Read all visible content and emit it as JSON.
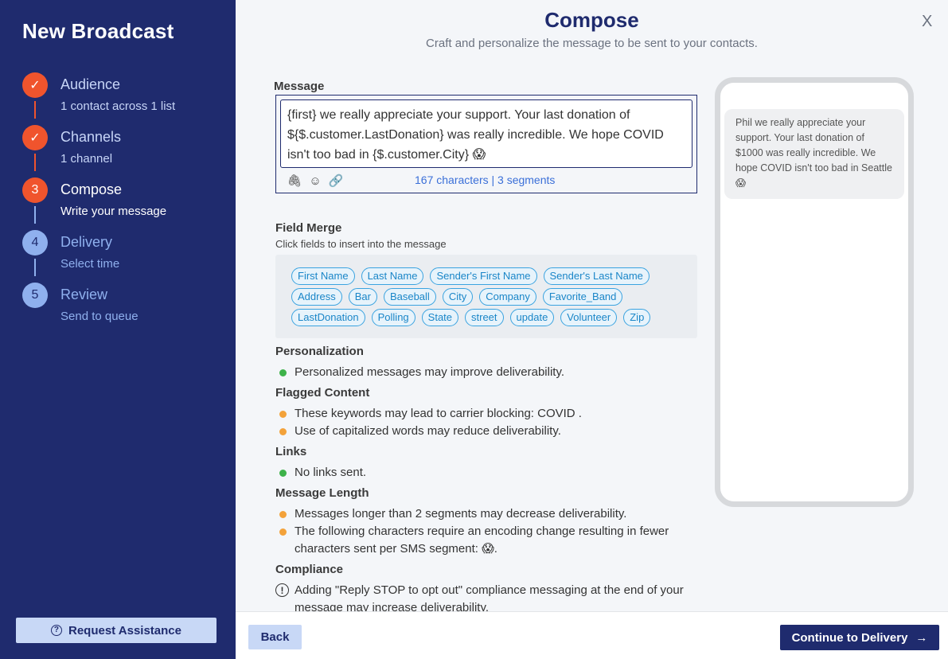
{
  "sidebar": {
    "title": "New Broadcast",
    "steps": [
      {
        "marker": "✓",
        "title": "Audience",
        "subtitle": "1 contact across 1 list",
        "state": "done"
      },
      {
        "marker": "✓",
        "title": "Channels",
        "subtitle": "1 channel",
        "state": "done"
      },
      {
        "marker": "3",
        "title": "Compose",
        "subtitle": "Write your message",
        "state": "current"
      },
      {
        "marker": "4",
        "title": "Delivery",
        "subtitle": "Select time",
        "state": "future"
      },
      {
        "marker": "5",
        "title": "Review",
        "subtitle": "Send to queue",
        "state": "future"
      }
    ],
    "assist_label": "Request Assistance",
    "assist_icon": "?"
  },
  "header": {
    "title": "Compose",
    "subtitle": "Craft and personalize the message to be sent to your contacts.",
    "close": "X"
  },
  "message": {
    "label": "Message",
    "text": "{first} we really appreciate your support.  Your last donation of ${$.customer.LastDonation} was really incredible.  We hope COVID isn't too bad in {$.customer.City} 😱",
    "count": "167 characters | 3 segments",
    "tool_icons": {
      "attach": "🖇",
      "emoji": "☺",
      "link": "🔗"
    }
  },
  "field_merge": {
    "label": "Field Merge",
    "hint": "Click fields to insert into the message",
    "rows": [
      [
        "First Name",
        "Last Name",
        "Sender's First Name",
        "Sender's Last Name"
      ],
      [
        "Address",
        "Bar",
        "Baseball",
        "City",
        "Company",
        "Favorite_Band"
      ],
      [
        "LastDonation",
        "Polling",
        "State",
        "street",
        "update",
        "Volunteer",
        "Zip"
      ]
    ]
  },
  "checks": {
    "personalization": {
      "title": "Personalization",
      "items": [
        "Personalized messages may improve deliverability."
      ]
    },
    "flagged": {
      "title": "Flagged Content",
      "items": [
        "These keywords may lead to carrier blocking: COVID .",
        "Use of capitalized words may reduce deliverability."
      ]
    },
    "links": {
      "title": "Links",
      "items": [
        "No links sent."
      ]
    },
    "length": {
      "title": "Message Length",
      "items": [
        "Messages longer than 2 segments may decrease deliverability.",
        "The following characters require an encoding change resulting in fewer characters sent per SMS segment: 😱."
      ]
    },
    "compliance": {
      "title": "Compliance",
      "items": [
        "Adding \"Reply STOP to opt out\" compliance messaging at the end of your message may increase deliverability."
      ],
      "icon": "!"
    }
  },
  "preview": {
    "text": "Phil we really appreciate your support. Your last donation of $1000 was really incredible. We hope COVID isn't too bad in Seattle 😱"
  },
  "footer": {
    "back_label": "Back",
    "continue_label": "Continue to Delivery",
    "continue_icon": "→"
  },
  "colors": {
    "sidebar": "#1f2b6e",
    "accent": "#f0542d",
    "future": "#8fb0ee",
    "chip": "#3aa3e0",
    "ok": "#3db24a",
    "warn": "#f3a23a"
  }
}
